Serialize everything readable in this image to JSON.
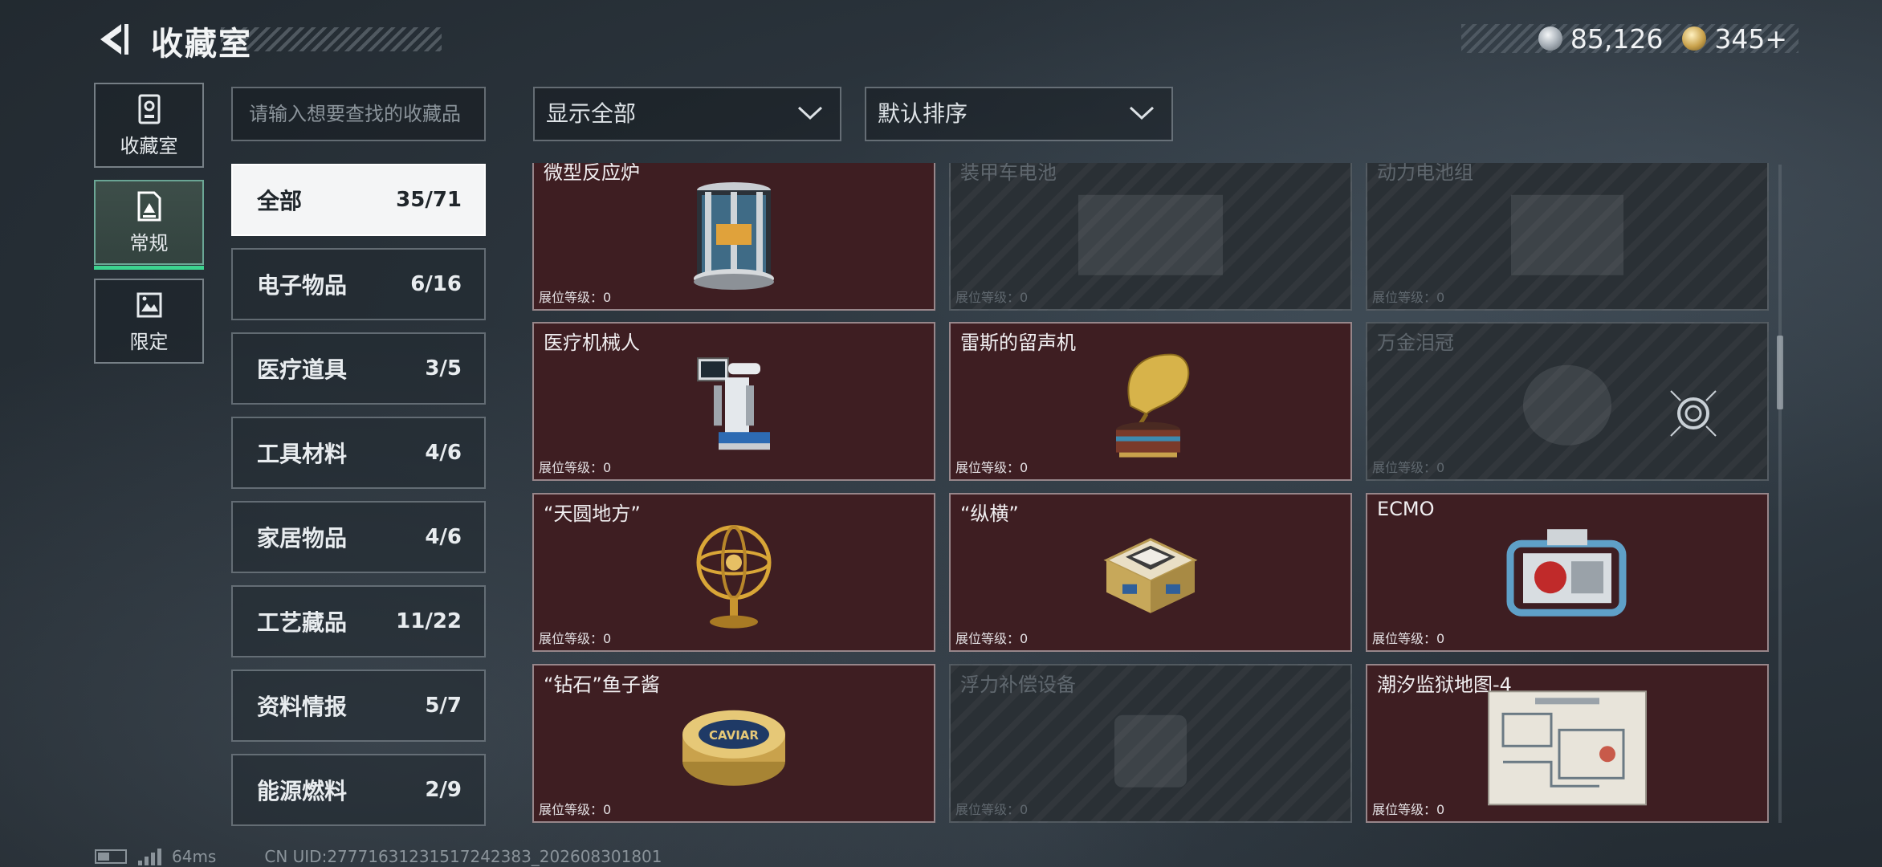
{
  "header": {
    "title": "收藏室",
    "silver_amount": "85,126",
    "gold_amount": "345+"
  },
  "side_tabs": [
    {
      "label": "收藏室",
      "icon": "vault-icon",
      "active": false
    },
    {
      "label": "常规",
      "icon": "document-icon",
      "active": true
    },
    {
      "label": "限定",
      "icon": "landscape-icon",
      "active": false
    }
  ],
  "search": {
    "placeholder": "请输入想要查找的收藏品"
  },
  "categories": [
    {
      "label": "全部",
      "count": "35/71",
      "active": true
    },
    {
      "label": "电子物品",
      "count": "6/16"
    },
    {
      "label": "医疗道具",
      "count": "3/5"
    },
    {
      "label": "工具材料",
      "count": "4/6"
    },
    {
      "label": "家居物品",
      "count": "4/6"
    },
    {
      "label": "工艺藏品",
      "count": "11/22"
    },
    {
      "label": "资料情报",
      "count": "5/7"
    },
    {
      "label": "能源燃料",
      "count": "2/9"
    }
  ],
  "filters": {
    "display": "显示全部",
    "sort": "默认排序"
  },
  "cards": [
    {
      "name": "微型反应炉",
      "level": "展位等级：0",
      "locked": false,
      "icon": "reactor-icon"
    },
    {
      "name": "装甲车电池",
      "level": "展位等级：0",
      "locked": true,
      "icon": "battery-icon"
    },
    {
      "name": "动力电池组",
      "level": "展位等级：0",
      "locked": true,
      "icon": "battery-pack-icon"
    },
    {
      "name": "医疗机械人",
      "level": "展位等级：0",
      "locked": false,
      "icon": "medical-robot-icon"
    },
    {
      "name": "雷斯的留声机",
      "level": "展位等级：0",
      "locked": false,
      "icon": "gramophone-icon"
    },
    {
      "name": "万金泪冠",
      "level": "展位等级：0",
      "locked": true,
      "icon": "crown-icon"
    },
    {
      "name": "“天圆地方”",
      "level": "展位等级：0",
      "locked": false,
      "icon": "armillary-sphere-icon"
    },
    {
      "name": "“纵横”",
      "level": "展位等级：0",
      "locked": false,
      "icon": "chess-box-icon"
    },
    {
      "name": "ECMO",
      "level": "展位等级：0",
      "locked": false,
      "icon": "ecmo-machine-icon"
    },
    {
      "name": "“钻石”鱼子酱",
      "level": "展位等级：0",
      "locked": false,
      "icon": "caviar-tin-icon",
      "label": "CAVIAR"
    },
    {
      "name": "浮力补偿设备",
      "level": "展位等级：0",
      "locked": true,
      "icon": "bcd-icon"
    },
    {
      "name": "潮汐监狱地图-4",
      "level": "展位等级：0",
      "locked": false,
      "icon": "map-icon"
    }
  ],
  "footer": {
    "ping": "64ms",
    "uid": "CN UID:27771631231517242383_202608301801"
  }
}
